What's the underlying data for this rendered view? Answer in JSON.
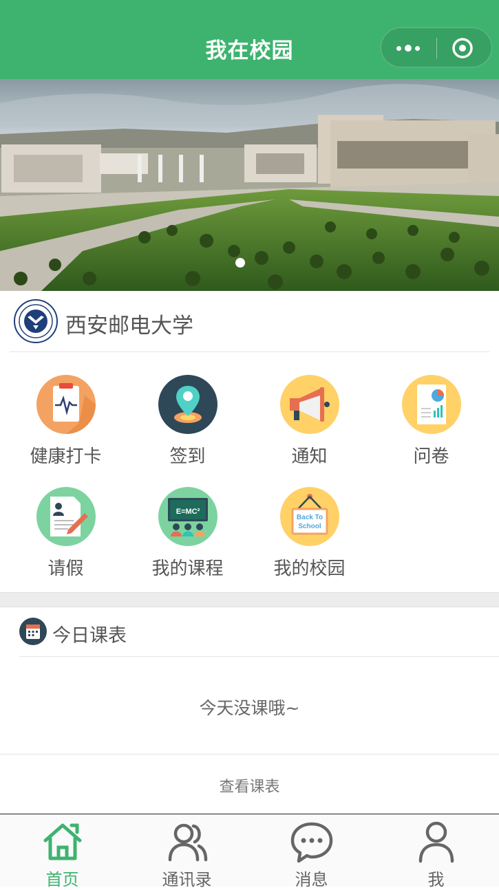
{
  "header": {
    "title": "我在校园"
  },
  "university": {
    "name": "西安邮电大学"
  },
  "features": [
    {
      "label": "健康打卡",
      "icon": "health-clipboard-icon"
    },
    {
      "label": "签到",
      "icon": "location-pin-icon"
    },
    {
      "label": "通知",
      "icon": "megaphone-icon"
    },
    {
      "label": "问卷",
      "icon": "survey-report-icon"
    },
    {
      "label": "请假",
      "icon": "leave-form-icon"
    },
    {
      "label": "我的课程",
      "icon": "classroom-board-icon"
    },
    {
      "label": "我的校园",
      "icon": "back-to-school-sign-icon",
      "sign_text_1": "Back To",
      "sign_text_2": "School",
      "board_text": "E=MC²"
    }
  ],
  "timetable": {
    "title": "今日课表",
    "empty_text": "今天没课哦~",
    "view_label": "查看课表"
  },
  "tabs": [
    {
      "label": "首页",
      "icon": "home-icon",
      "active": true
    },
    {
      "label": "通讯录",
      "icon": "contacts-icon",
      "active": false
    },
    {
      "label": "消息",
      "icon": "message-bubble-icon",
      "active": false
    },
    {
      "label": "我",
      "icon": "person-icon",
      "active": false
    }
  ],
  "colors": {
    "brand": "#3eb36f",
    "text": "#555555",
    "inactive_tab": "#666666"
  }
}
